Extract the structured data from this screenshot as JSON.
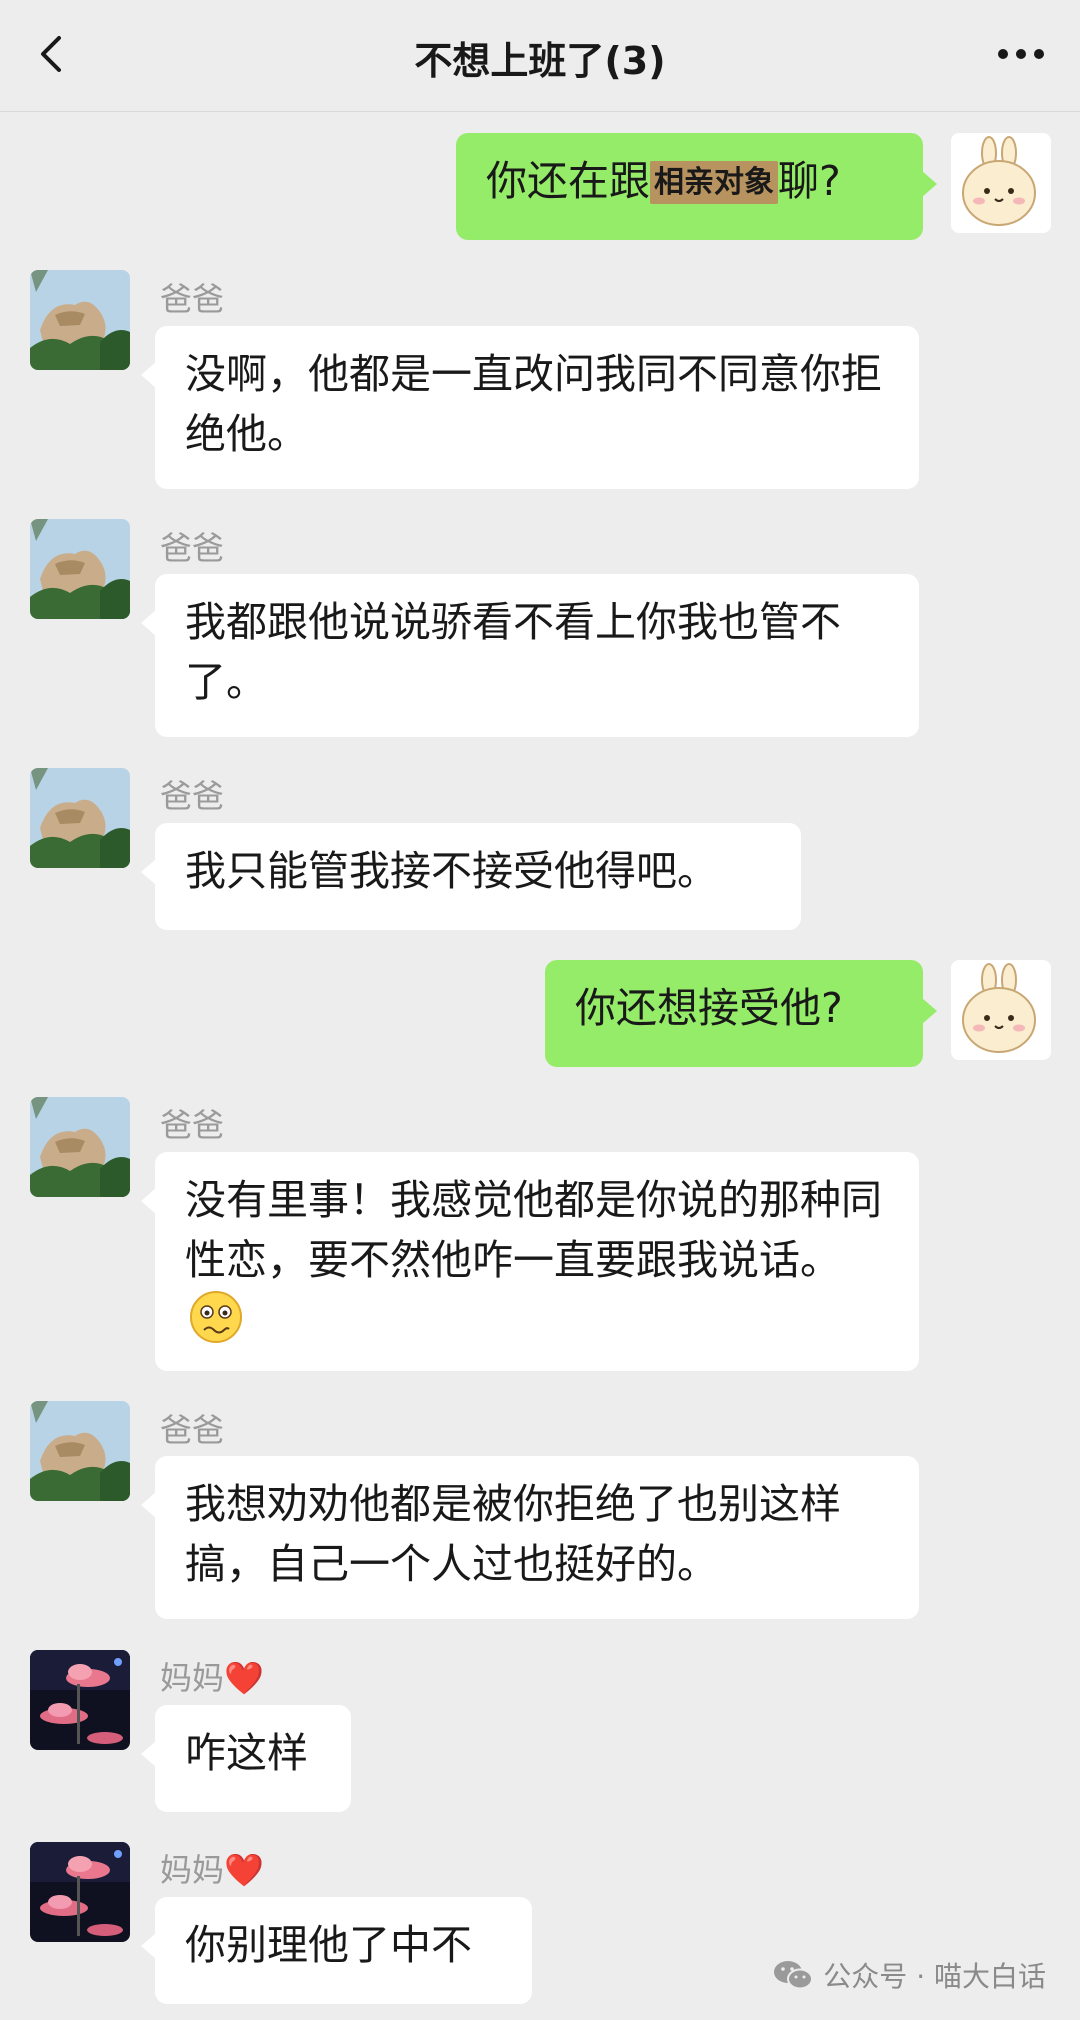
{
  "header": {
    "title": "不想上班了(3)",
    "back_icon": "chevron-left-icon",
    "more_icon": "more-dots-icon"
  },
  "messages": [
    {
      "side": "out",
      "pre": "你还在跟",
      "highlight": "相亲对象",
      "post": "聊?"
    },
    {
      "side": "in",
      "sender": "爸爸",
      "text": "没啊，他都是一直改问我同不同意你拒绝他。"
    },
    {
      "side": "in",
      "sender": "爸爸",
      "text": "我都跟他说说骄看不看上你我也管不了。"
    },
    {
      "side": "in",
      "sender": "爸爸",
      "text": "我只能管我接不接受他得吧。"
    },
    {
      "side": "out",
      "text": "你还想接受他?"
    },
    {
      "side": "in",
      "sender": "爸爸",
      "text": "没有里事！我感觉他都是你说的那种同性恋，要不然他咋一直要跟我说话。",
      "emoji": "worried-face-emoji"
    },
    {
      "side": "in",
      "sender": "爸爸",
      "text": "我想劝劝他都是被你拒绝了也别这样搞，自己一个人过也挺好的。"
    },
    {
      "side": "in",
      "sender": "妈妈",
      "sender_suffix": "❤️",
      "text": "咋这样"
    },
    {
      "side": "in",
      "sender": "妈妈",
      "sender_suffix": "❤️",
      "text": "你别理他了中不"
    }
  ],
  "watermark": {
    "icon": "wechat-icon",
    "text": "公众号 · 喵大白话"
  },
  "colors": {
    "background": "#ededed",
    "outgoing_bubble": "#95ec69",
    "incoming_bubble": "#ffffff",
    "highlight": "#b7935f"
  }
}
